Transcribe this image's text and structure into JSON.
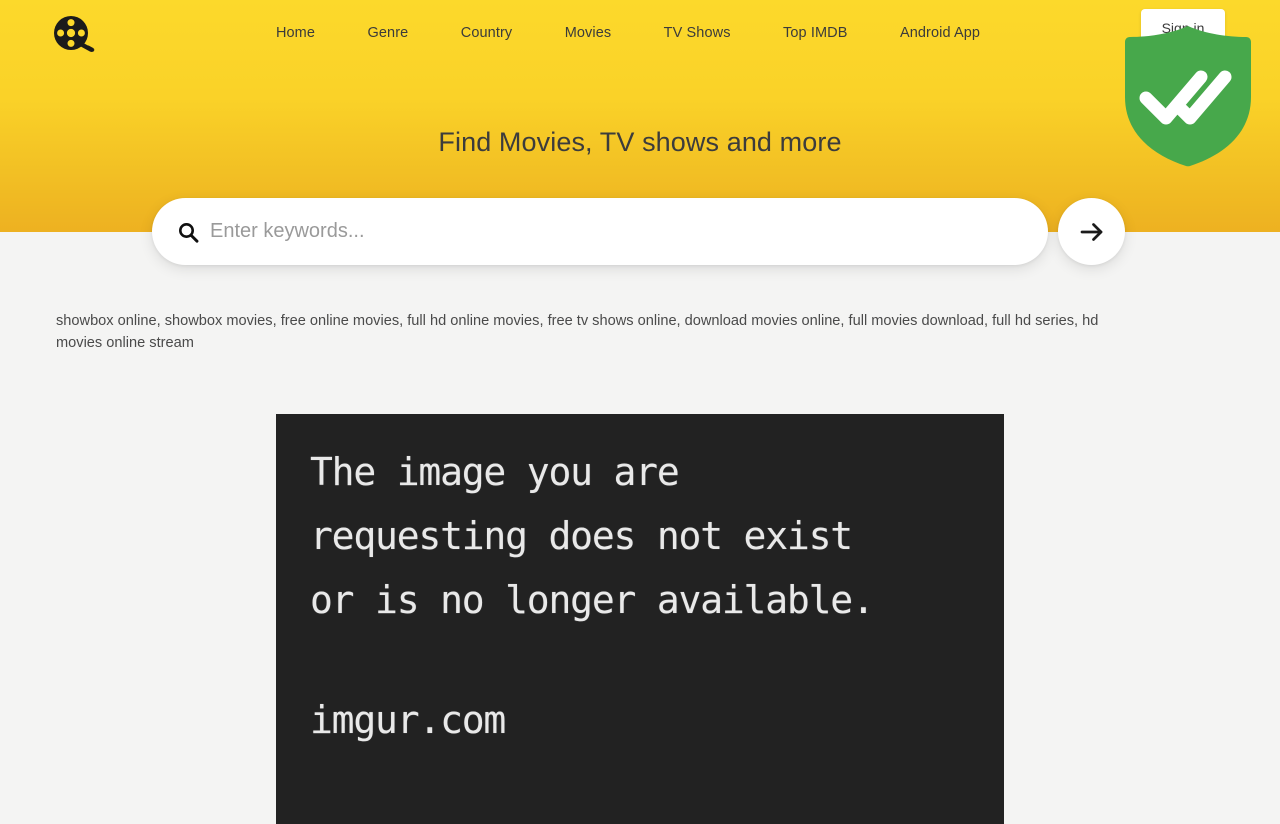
{
  "site": {
    "logo_icon": "film-reel-icon"
  },
  "nav": {
    "items": [
      {
        "label": "Home"
      },
      {
        "label": "Genre"
      },
      {
        "label": "Country"
      },
      {
        "label": "Movies"
      },
      {
        "label": "TV Shows"
      },
      {
        "label": "Top IMDB"
      },
      {
        "label": "Android App"
      }
    ]
  },
  "account": {
    "label": "Sign in"
  },
  "badge": {
    "icon": "verified-shield-double-check-icon",
    "color": "#47a84b",
    "check_color": "#ffffff"
  },
  "hero": {
    "headline": "Find Movies, TV shows and more",
    "gradient_top": "#fcd92b",
    "gradient_bottom": "#edb121"
  },
  "search": {
    "icon": "search-icon",
    "value": "",
    "placeholder": "Enter keywords...",
    "submit_icon": "arrow-right-icon"
  },
  "keywords": {
    "text": "showbox online, showbox movies, free online movies, full hd online movies, free tv shows online, download movies online, full movies download, full hd series, hd movies online stream"
  },
  "figure": {
    "message": "The image you are\nrequesting does not exist\nor is no longer available.",
    "domain": "imgur.com",
    "background": "#222222",
    "text_color": "#e9e9e9"
  }
}
